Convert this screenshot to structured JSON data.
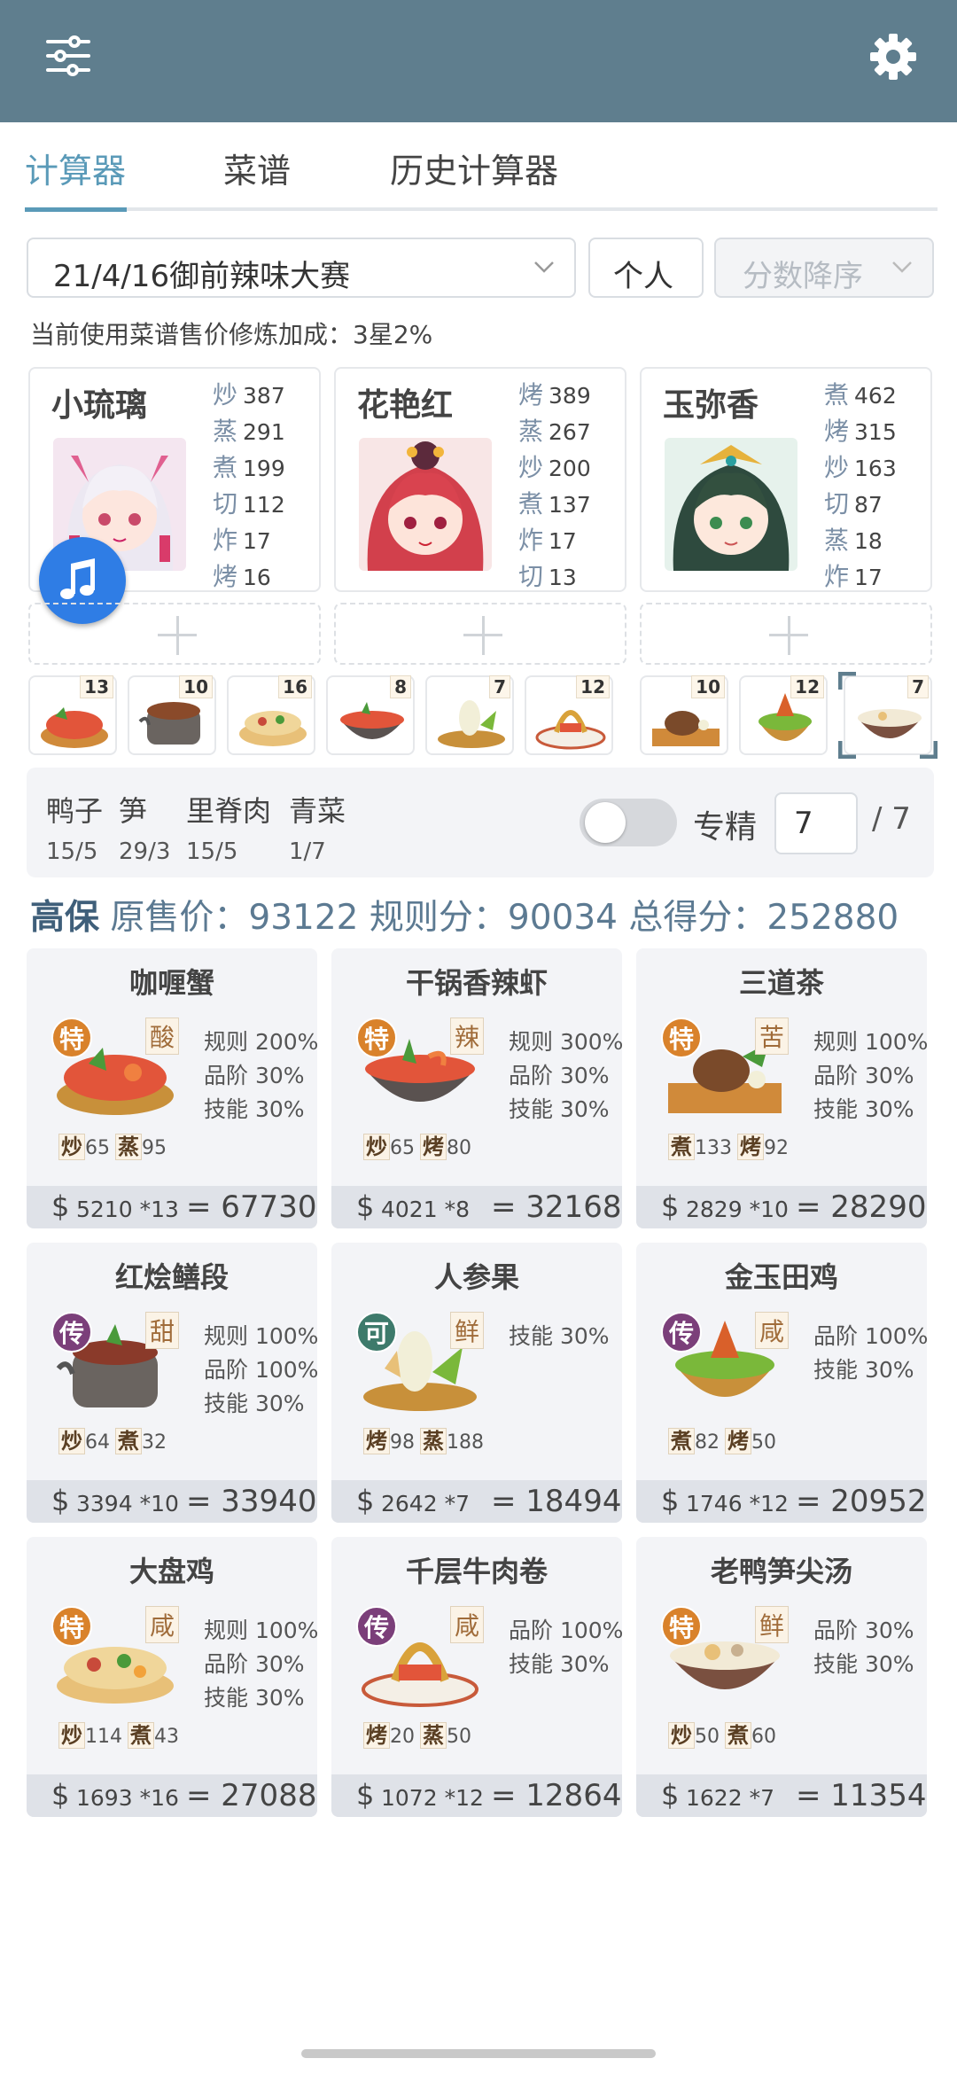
{
  "tabs": [
    "计算器",
    "菜谱",
    "历史计算器"
  ],
  "controls": {
    "contest": "21/4/16御前辣味大赛",
    "mode": "个人",
    "sort": "分数降序"
  },
  "bonus_text": "当前使用菜谱售价修炼加成：3星2%",
  "chefs": [
    {
      "name": "小琉璃",
      "stats": [
        [
          "炒",
          "387"
        ],
        [
          "蒸",
          "291"
        ],
        [
          "煮",
          "199"
        ],
        [
          "切",
          "112"
        ],
        [
          "炸",
          "17"
        ],
        [
          "烤",
          "16"
        ]
      ]
    },
    {
      "name": "花艳红",
      "stats": [
        [
          "烤",
          "389"
        ],
        [
          "蒸",
          "267"
        ],
        [
          "炒",
          "200"
        ],
        [
          "煮",
          "137"
        ],
        [
          "炸",
          "17"
        ],
        [
          "切",
          "13"
        ]
      ]
    },
    {
      "name": "玉弥香",
      "stats": [
        [
          "煮",
          "462"
        ],
        [
          "烤",
          "315"
        ],
        [
          "炒",
          "163"
        ],
        [
          "切",
          "87"
        ],
        [
          "蒸",
          "18"
        ],
        [
          "炸",
          "17"
        ]
      ]
    }
  ],
  "dish_counts": [
    "13",
    "10",
    "16",
    "8",
    "7",
    "12",
    "10",
    "12",
    "7"
  ],
  "ingredients": [
    {
      "name": "鸭子",
      "qty": "15/5"
    },
    {
      "name": "笋",
      "qty": "29/3"
    },
    {
      "name": "里脊肉",
      "qty": "15/5"
    },
    {
      "name": "青菜",
      "qty": "1/7"
    }
  ],
  "specialize": {
    "label": "专精",
    "value": "7",
    "max": "/ 7"
  },
  "summary": {
    "grade": "高保",
    "text": "原售价：93122 规则分：90034 总得分：252880"
  },
  "recipes": [
    {
      "name": "咖喱蟹",
      "badge": "特",
      "flavor": "酸",
      "buffs": [
        "规则 200%",
        "品阶 30%",
        "技能 30%"
      ],
      "skills": [
        [
          "炒",
          "65"
        ],
        [
          "蒸",
          "95"
        ]
      ],
      "price": "5210 *13",
      "total": "= 67730"
    },
    {
      "name": "干锅香辣虾",
      "badge": "特",
      "flavor": "辣",
      "buffs": [
        "规则 300%",
        "品阶 30%",
        "技能 30%"
      ],
      "skills": [
        [
          "炒",
          "65"
        ],
        [
          "烤",
          "80"
        ]
      ],
      "price": "4021 *8",
      "total": "= 32168"
    },
    {
      "name": "三道茶",
      "badge": "特",
      "flavor": "苦",
      "buffs": [
        "规则 100%",
        "品阶 30%",
        "技能 30%"
      ],
      "skills": [
        [
          "煮",
          "133"
        ],
        [
          "烤",
          "92"
        ]
      ],
      "price": "2829 *10",
      "total": "= 28290"
    },
    {
      "name": "红烩鳝段",
      "badge": "传",
      "flavor": "甜",
      "buffs": [
        "规则 100%",
        "品阶 100%",
        "技能 30%"
      ],
      "skills": [
        [
          "炒",
          "64"
        ],
        [
          "煮",
          "32"
        ]
      ],
      "price": "3394 *10",
      "total": "= 33940"
    },
    {
      "name": "人参果",
      "badge": "可",
      "flavor": "鲜",
      "buffs": [
        "技能 30%"
      ],
      "skills": [
        [
          "烤",
          "98"
        ],
        [
          "蒸",
          "188"
        ]
      ],
      "price": "2642 *7",
      "total": "= 18494"
    },
    {
      "name": "金玉田鸡",
      "badge": "传",
      "flavor": "咸",
      "buffs": [
        "品阶 100%",
        "技能 30%"
      ],
      "skills": [
        [
          "煮",
          "82"
        ],
        [
          "烤",
          "50"
        ]
      ],
      "price": "1746 *12",
      "total": "= 20952"
    },
    {
      "name": "大盘鸡",
      "badge": "特",
      "flavor": "咸",
      "buffs": [
        "规则 100%",
        "品阶 30%",
        "技能 30%"
      ],
      "skills": [
        [
          "炒",
          "114"
        ],
        [
          "煮",
          "43"
        ]
      ],
      "price": "1693 *16",
      "total": "= 27088"
    },
    {
      "name": "千层牛肉卷",
      "badge": "传",
      "flavor": "咸",
      "buffs": [
        "品阶 100%",
        "技能 30%"
      ],
      "skills": [
        [
          "烤",
          "20"
        ],
        [
          "蒸",
          "50"
        ]
      ],
      "price": "1072 *12",
      "total": "= 12864"
    },
    {
      "name": "老鸭笋尖汤",
      "badge": "特",
      "flavor": "鲜",
      "buffs": [
        "品阶 30%",
        "技能 30%"
      ],
      "skills": [
        [
          "炒",
          "50"
        ],
        [
          "煮",
          "60"
        ]
      ],
      "price": "1622 *7",
      "total": "= 11354"
    }
  ],
  "colors": {
    "header": "#5f7e8e",
    "accent": "#5a9ab8",
    "badge_te": "#d9822b",
    "badge_chuan": "#7b3f7a",
    "badge_ke": "#3d7a6b"
  },
  "icons": {
    "menu": "sliders-icon",
    "settings": "gear-icon",
    "fab": "music-note-icon"
  }
}
